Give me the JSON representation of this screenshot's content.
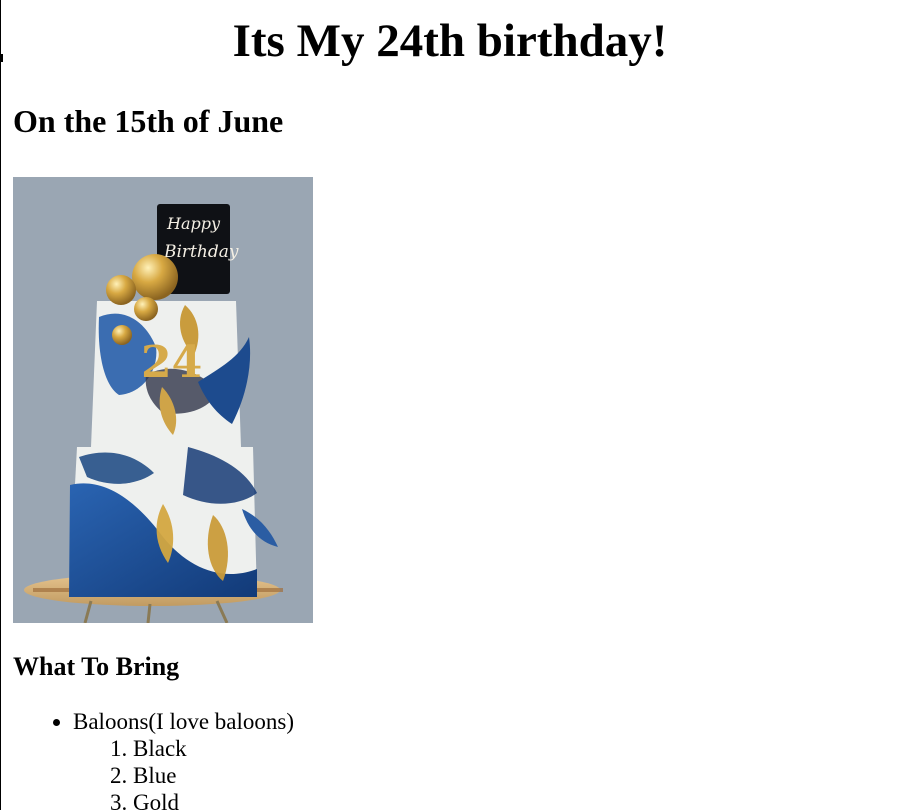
{
  "page": {
    "title": "Its My 24th birthday!",
    "subtitle": "On the 15th of June",
    "image": {
      "topper_line1": "Happy",
      "topper_line2": "Birthday",
      "cake_number": "24",
      "colors": {
        "background": "#9aa6b3",
        "frosting": "#eef0ee",
        "blue": "#1f4f95",
        "gold": "#c9a24a"
      }
    },
    "section_title": "What To Bring",
    "bring_items": [
      {
        "label": "Baloons(I love baloons)",
        "sub_items": [
          "Black",
          "Blue",
          "Gold"
        ]
      }
    ]
  }
}
